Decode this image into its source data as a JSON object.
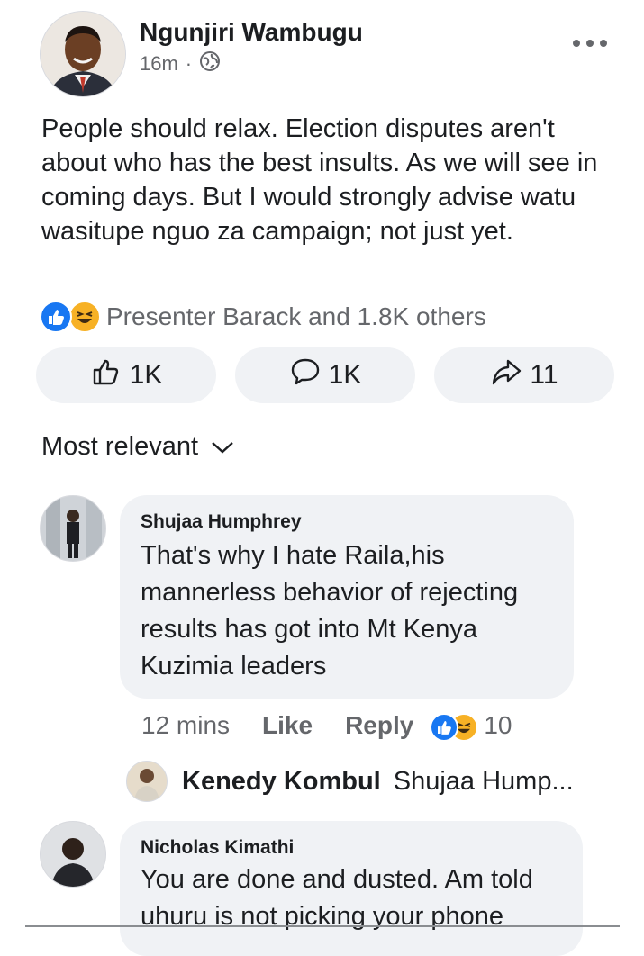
{
  "post": {
    "author": "Ngunjiri Wambugu",
    "time": "16m",
    "separator": "·",
    "privacy_icon": "globe-icon",
    "more_icon": "more-options-icon",
    "text": "People should relax. Election disputes aren't about who has the best insults. As we will see in coming days. But I would strongly advise watu wasitupe nguo za campaign; not just yet.",
    "reactions": {
      "icons": [
        "like-reaction-icon",
        "haha-reaction-icon"
      ],
      "summary": "Presenter Barack and 1.8K others"
    },
    "actions": [
      {
        "icon": "thumbs-up-icon",
        "count": "1K"
      },
      {
        "icon": "comment-icon",
        "count": "1K"
      },
      {
        "icon": "share-icon",
        "count": "11"
      }
    ]
  },
  "sort": {
    "label": "Most relevant",
    "icon": "chevron-down-icon"
  },
  "comments": [
    {
      "author": "Shujaa Humphrey",
      "text": [
        "That's why I hate Raila,his",
        "mannerless behavior of rejecting",
        "results has got into Mt Kenya",
        "Kuzimia leaders"
      ],
      "time": "12 mins",
      "like_label": "Like",
      "reply_label": "Reply",
      "reaction_count": "10",
      "reply_preview": {
        "author": "Kenedy Kombul",
        "snippet": "Shujaa Hump..."
      }
    },
    {
      "author": "Nicholas Kimathi",
      "text": [
        "You are done and dusted. Am told",
        "uhuru is not picking your phone"
      ]
    }
  ],
  "colors": {
    "accent_blue": "#1877f2",
    "haha_yellow": "#f7b125",
    "bubble_gray": "#f0f2f5",
    "secondary_text": "#65676b"
  }
}
